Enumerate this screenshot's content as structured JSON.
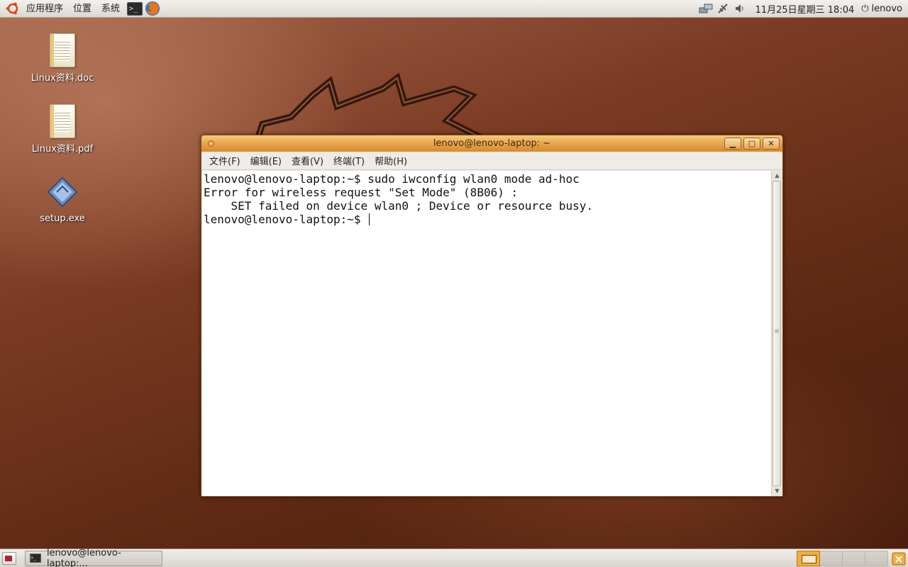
{
  "top_panel": {
    "menus": [
      "应用程序",
      "位置",
      "系统"
    ],
    "clock": "11月25日星期三 18:04",
    "user": "lenovo"
  },
  "desktop_icons": [
    {
      "label": "Linux资料.doc",
      "icon": "document-icon"
    },
    {
      "label": "Linux资料.pdf",
      "icon": "document-icon"
    },
    {
      "label": "setup.exe",
      "icon": "executable-icon"
    }
  ],
  "terminal": {
    "title": "lenovo@lenovo-laptop: ~",
    "menu": [
      "文件(F)",
      "编辑(E)",
      "查看(V)",
      "终端(T)",
      "帮助(H)"
    ],
    "lines": [
      "lenovo@lenovo-laptop:~$ sudo iwconfig wlan0 mode ad-hoc",
      "Error for wireless request \"Set Mode\" (8B06) :",
      "    SET failed on device wlan0 ; Device or resource busy.",
      "lenovo@lenovo-laptop:~$ "
    ]
  },
  "bottom_panel": {
    "task_label": "lenovo@lenovo-laptop:..."
  },
  "colors": {
    "titlebar_accent": "#e8a24a",
    "active_workspace": "#f2ad3a"
  }
}
